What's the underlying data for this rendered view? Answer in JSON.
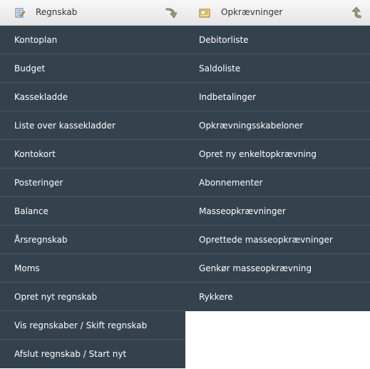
{
  "left": {
    "title": "Regnskab",
    "icon": "ledger-icon",
    "action_icon": "arrow-right-down-icon",
    "items": [
      "Kontoplan",
      "Budget",
      "Kassekladde",
      "Liste over kassekladder",
      "Kontokort",
      "Posteringer",
      "Balance",
      "Årsregnskab",
      "Moms",
      "Opret nyt regnskab",
      "Vis regnskaber / Skift regnskab",
      "Afslut regnskab / Start nyt"
    ]
  },
  "right": {
    "title": "Opkrævninger",
    "icon": "invoice-icon",
    "action_icon": "arrow-up-icon",
    "items": [
      "Debitorliste",
      "Saldoliste",
      "Indbetalinger",
      "Opkrævningsskabeloner",
      "Opret ny enkeltopkrævning",
      "Abonnementer",
      "Masseopkrævninger",
      "Oprettede masseopkrævninger",
      "Genkør masseopkrævning",
      "Rykkere"
    ]
  },
  "colors": {
    "menu_bg": "#34424e",
    "menu_divider": "#4a5864",
    "menu_text": "#ffffff",
    "header_bg": "#ececec"
  }
}
